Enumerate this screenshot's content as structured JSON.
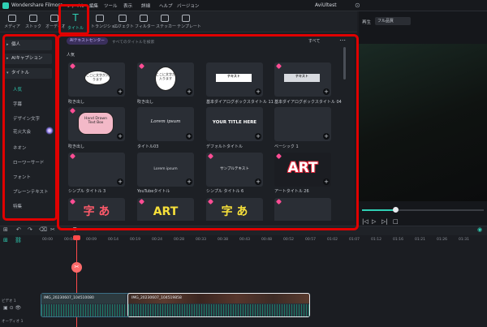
{
  "app": {
    "title": "Wondershare Filmora",
    "project": "AviUltest"
  },
  "menus": [
    "ファイル",
    "編集",
    "ツール",
    "表示",
    "詳細",
    "ヘルプ",
    "バージョン"
  ],
  "toolbar": {
    "tabs": [
      {
        "label": "メディア",
        "icon": "media-icon"
      },
      {
        "label": "ストック",
        "icon": "stock-icon"
      },
      {
        "label": "オーディオ",
        "icon": "audio-icon"
      },
      {
        "label": "タイトル",
        "icon": "title-icon"
      },
      {
        "label": "トランジション",
        "icon": "transition-icon"
      },
      {
        "label": "エフェクト",
        "icon": "effect-icon"
      },
      {
        "label": "フィルター",
        "icon": "filter-icon"
      },
      {
        "label": "ステッカー",
        "icon": "sticker-icon"
      },
      {
        "label": "テンプレート",
        "icon": "template-icon"
      }
    ],
    "active_glyph": "T"
  },
  "sidebar": {
    "sections": [
      "個人",
      "AIキャプション",
      "タイトル"
    ],
    "items": [
      "人気",
      "字幕",
      "デザイン文字",
      "花火大会",
      "ネオン",
      "ローワーサード",
      "フォント",
      "プレーンテキスト",
      "特集"
    ]
  },
  "content": {
    "ai_chip": "AIテキストセンター",
    "search_placeholder": "すべてのタイトルを検索",
    "filter": "すべて",
    "section_title": "人気",
    "cards": [
      {
        "label": "吹き出し",
        "text": "ここに文字が入ります"
      },
      {
        "label": "吹き出し",
        "text": "ここに文字が入ります"
      },
      {
        "label": "基本ダイアログボックスタイトル 11",
        "text": "テキスト"
      },
      {
        "label": "基本ダイアログボックスタイトル 04",
        "text": "テキスト"
      },
      {
        "label": "吹き出し",
        "text": "Hand Drawn Text Box"
      },
      {
        "label": "タイトル03",
        "text": "Lorem ipsum"
      },
      {
        "label": "デフォルトタイトル",
        "text": "YOUR TITLE HERE"
      },
      {
        "label": "ベーシック 1",
        "text": ""
      },
      {
        "label": "シンプル タイトル 3",
        "text": ""
      },
      {
        "label": "YouTubeタイトル",
        "text": "Lorem ipsum"
      },
      {
        "label": "シンプル タイトル 6",
        "text": "サンプルテキスト"
      },
      {
        "label": "アートタイトル 26",
        "text": "ART"
      },
      {
        "label": "",
        "text": "字 あ"
      },
      {
        "label": "",
        "text": "ART"
      },
      {
        "label": "",
        "text": "字 あ"
      },
      {
        "label": "",
        "text": ""
      }
    ]
  },
  "preview": {
    "tab": "再生",
    "quality": "フル品質",
    "progress": 0.27
  },
  "timeline": {
    "timecodes": [
      "00:00",
      "00:04",
      "00:09",
      "00:14",
      "00:19",
      "00:24",
      "00:28",
      "00:33",
      "00:38",
      "00:43",
      "00:48",
      "00:52",
      "00:57",
      "01:02",
      "01:07",
      "01:12",
      "01:16",
      "01:21",
      "01:26",
      "01:31"
    ],
    "clips": [
      "IMG_20230607_104510080",
      "IMG_20230607_104519858"
    ],
    "tracks": [
      "ビデオ 1",
      "オーディオ 1"
    ]
  },
  "colors": {
    "accent": "#2fd0b5",
    "highlight": "#e00000",
    "playhead": "#ff4a4a"
  }
}
